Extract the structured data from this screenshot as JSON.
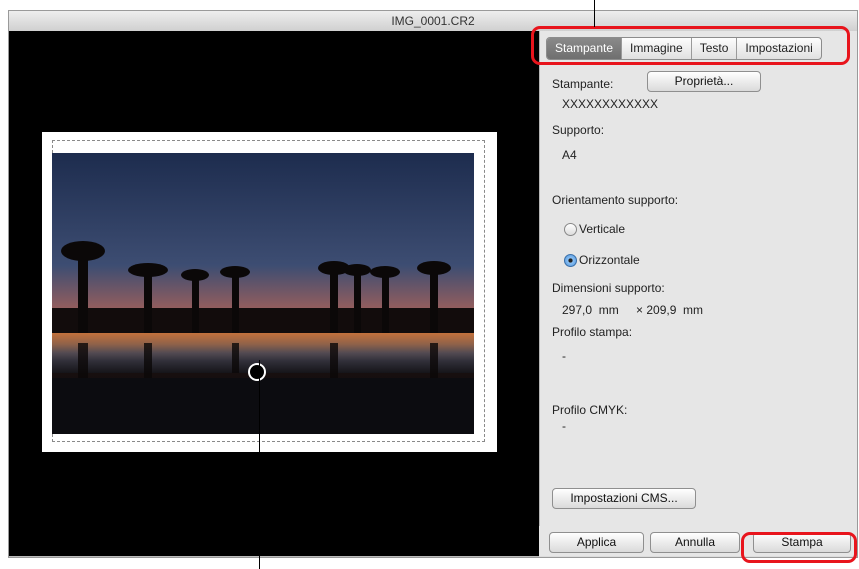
{
  "window": {
    "title": "IMG_0001.CR2"
  },
  "tabs": [
    "Stampante",
    "Immagine",
    "Testo",
    "Impostazioni"
  ],
  "panel": {
    "printer_label": "Stampante:",
    "properties_button": "Proprietà...",
    "printer_value": "XXXXXXXXXXXX",
    "media_label": "Supporto:",
    "media_value": "A4",
    "orientation_label": "Orientamento supporto:",
    "orientation_options": [
      "Verticale",
      "Orizzontale"
    ],
    "orientation_selected": "Orizzontale",
    "dimensions_label": "Dimensioni supporto:",
    "dim_width": "297,0  mm",
    "dim_height": "× 209,9  mm",
    "print_profile_label": "Profilo stampa:",
    "print_profile_value": "-",
    "cmyk_label": "Profilo CMYK:",
    "cmyk_value": "-",
    "cms_button": "Impostazioni CMS..."
  },
  "buttons": {
    "apply": "Applica",
    "cancel": "Annulla",
    "print": "Stampa"
  },
  "colors": {
    "callout": "#e8141c",
    "active_tab": "#7a7a7a"
  }
}
